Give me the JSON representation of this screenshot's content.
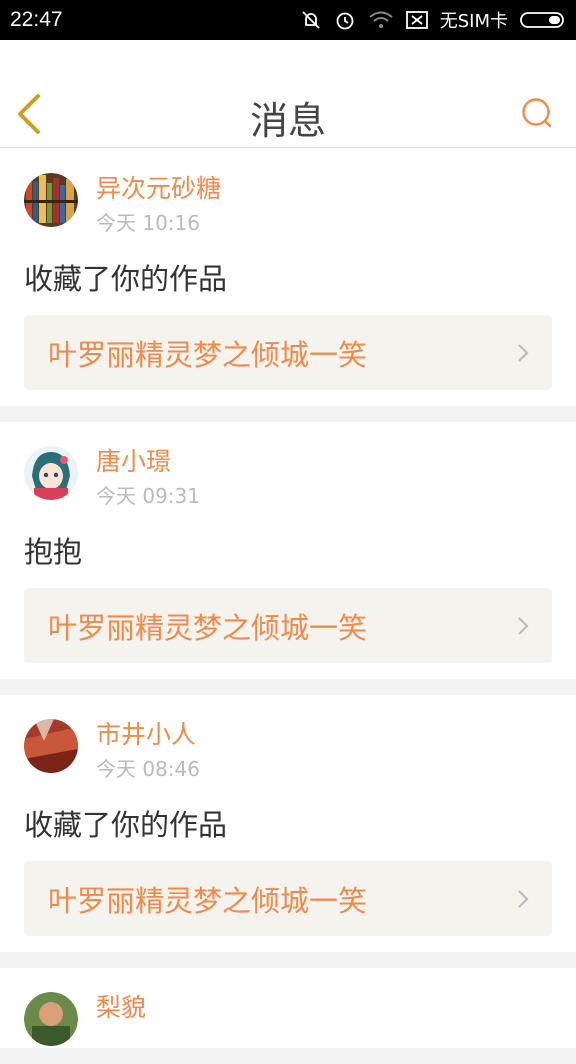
{
  "status": {
    "time": "22:47",
    "sim_text": "无SIM卡"
  },
  "header": {
    "title": "消息"
  },
  "colors": {
    "accent": "#f08a4b",
    "back_icon": "#c9a020"
  },
  "messages": [
    {
      "name": "异次元砂糖",
      "time": "今天 10:16",
      "text": "收藏了你的作品",
      "work": "叶罗丽精灵梦之倾城一笑"
    },
    {
      "name": "唐小璟",
      "time": "今天 09:31",
      "text": "抱抱",
      "work": "叶罗丽精灵梦之倾城一笑"
    },
    {
      "name": "市井小人",
      "time": "今天 08:46",
      "text": "收藏了你的作品",
      "work": "叶罗丽精灵梦之倾城一笑"
    },
    {
      "name": "梨貌"
    }
  ]
}
